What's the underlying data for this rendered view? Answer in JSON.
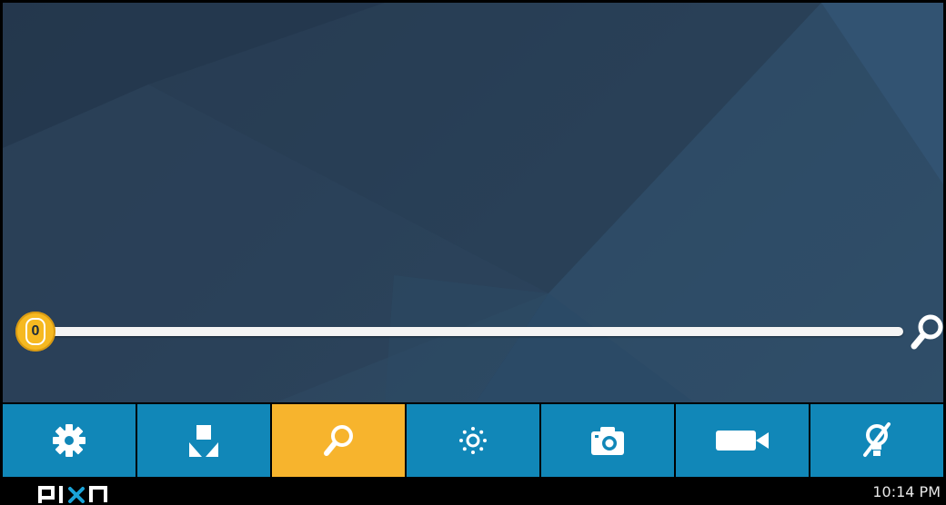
{
  "zoom": {
    "value_label": "0",
    "level": 0,
    "thumb_color": "#f6b921"
  },
  "toolbar": {
    "active_index": 2,
    "button_color": "#1187b8",
    "active_color": "#f7b42d",
    "buttons": [
      {
        "icon": "gear-icon"
      },
      {
        "icon": "download-icon"
      },
      {
        "icon": "zoom-icon"
      },
      {
        "icon": "brightness-icon"
      },
      {
        "icon": "camera-icon"
      },
      {
        "icon": "video-camera-icon"
      },
      {
        "icon": "light-off-icon"
      }
    ]
  },
  "statusbar": {
    "brand": "pixa",
    "time": "10:14 PM"
  }
}
